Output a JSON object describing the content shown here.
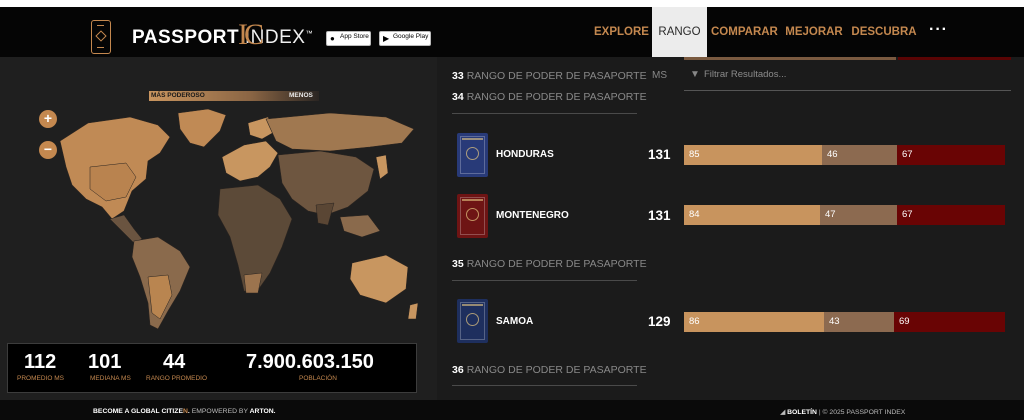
{
  "header": {
    "brand_bold": "PASSPORT",
    "brand_thin": "INDEX",
    "brand_tm": "™",
    "brand_mark": "IC",
    "app_store": "App Store",
    "google_play": "Google Play",
    "nav": [
      "EXPLORE",
      "RANGO",
      "COMPARAR",
      "MEJORAR",
      "DESCUBRA"
    ],
    "more": "···",
    "active_index": 1
  },
  "map": {
    "legend_more": "MÁS PODEROSO",
    "legend_less": "MENOS",
    "zoom_in": "+",
    "zoom_out": "−"
  },
  "stats": {
    "avg_ms": "112",
    "avg_ms_label": "PROMEDIO MS",
    "median_ms": "101",
    "median_ms_label": "MEDIANA MS",
    "avg_rank": "44",
    "avg_rank_label": "RANGO PROMEDIO",
    "population": "7.900.603.150",
    "population_label": "POBLACIÓN"
  },
  "ranking": {
    "ms_header": "MS",
    "filter_placeholder": "Filtrar Resultados...",
    "rank_label": "RANGO DE PODER DE PASAPORTE",
    "groups": [
      {
        "rank": "33"
      },
      {
        "rank": "34"
      },
      {
        "rank": "35"
      },
      {
        "rank": "36"
      }
    ],
    "countries": [
      {
        "name": "HONDURAS",
        "score": "131",
        "a": "85",
        "b": "46",
        "c": "67",
        "color": "#283a78"
      },
      {
        "name": "MONTENEGRO",
        "score": "131",
        "a": "84",
        "b": "47",
        "c": "67",
        "color": "#6e1414"
      },
      {
        "name": "SAMOA",
        "score": "129",
        "a": "86",
        "b": "43",
        "c": "69",
        "color": "#1e2f5e"
      }
    ]
  },
  "footer": {
    "left_1": "BECOME A GLOBAL CITIZE",
    "left_n": "N",
    "left_dot": ".",
    "left_2": "EMPOWERED BY",
    "left_3": "ARTON.",
    "right_1": "BOLETÍN",
    "right_2": "| © 2025 PASSPORT INDEX"
  },
  "colors": {
    "accent": "#c4884f",
    "bar_visa_free": "#c8945e",
    "bar_visa_on_arrival": "#8c6a50",
    "bar_visa_required": "#690404"
  }
}
